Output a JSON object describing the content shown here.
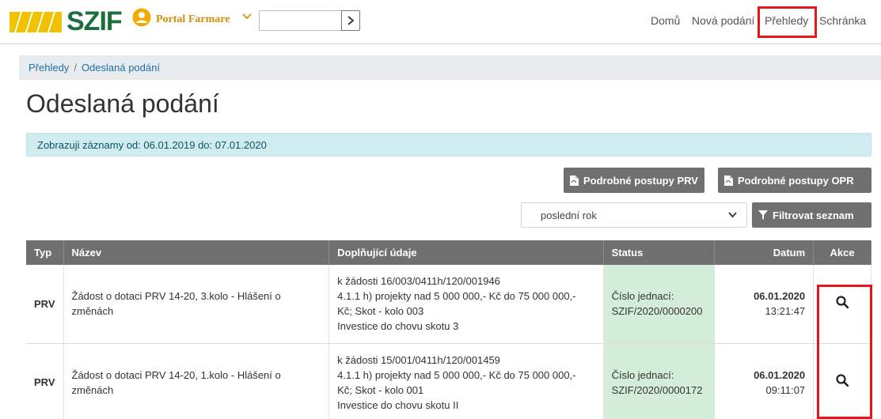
{
  "header": {
    "logo_text": "SZIF",
    "portal_label": "Portal Farmare",
    "search_placeholder": "",
    "nav": [
      "Domů",
      "Nová podání",
      "Přehledy",
      "Schránka"
    ]
  },
  "breadcrumb": {
    "items": [
      "Přehledy",
      "Odeslaná podání"
    ],
    "separator": "/"
  },
  "page_title": "Odeslaná podání",
  "info": "Zobrazuji záznamy od: 06.01.2019 do: 07.01.2020",
  "buttons": {
    "prv": "Podrobné postupy PRV",
    "opr": "Podrobné postupy OPR",
    "filter": "Filtrovat seznam"
  },
  "filter_select": {
    "value": "poslední rok"
  },
  "table": {
    "headers": [
      "Typ",
      "Název",
      "Doplňující údaje",
      "Status",
      "Datum",
      "Akce"
    ],
    "rows": [
      {
        "typ": "PRV",
        "nazev": "Žádost o dotaci PRV 14-20, 3.kolo - Hlášení o změnách",
        "doplnujici": [
          "k žádosti 16/003/0411h/120/001946",
          "4.1.1 h) projekty nad 5 000 000,- Kč do 75 000 000,-",
          "Kč; Skot - kolo 003",
          "Investice do chovu skotu 3"
        ],
        "status_label": "Číslo jednací:",
        "status_value": "SZIF/2020/0000200",
        "date": "06.01.2020",
        "time": "13:21:47"
      },
      {
        "typ": "PRV",
        "nazev": "Žádost o dotaci PRV 14-20, 1.kolo - Hlášení o změnách",
        "doplnujici": [
          "k žádosti 15/001/0411h/120/001459",
          "4.1.1 h) projekty nad 5 000 000,- Kč do 75 000 000,-",
          "Kč; Skot - kolo 001",
          "Investice do chovu skotu II"
        ],
        "status_label": "Číslo jednací:",
        "status_value": "SZIF/2020/0000172",
        "date": "06.01.2020",
        "time": "09:11:07"
      }
    ]
  },
  "colors": {
    "brand_green": "#1c6e3c",
    "brand_gold": "#c8920f",
    "highlight_red": "#e8141e",
    "button_gray": "#707070"
  }
}
